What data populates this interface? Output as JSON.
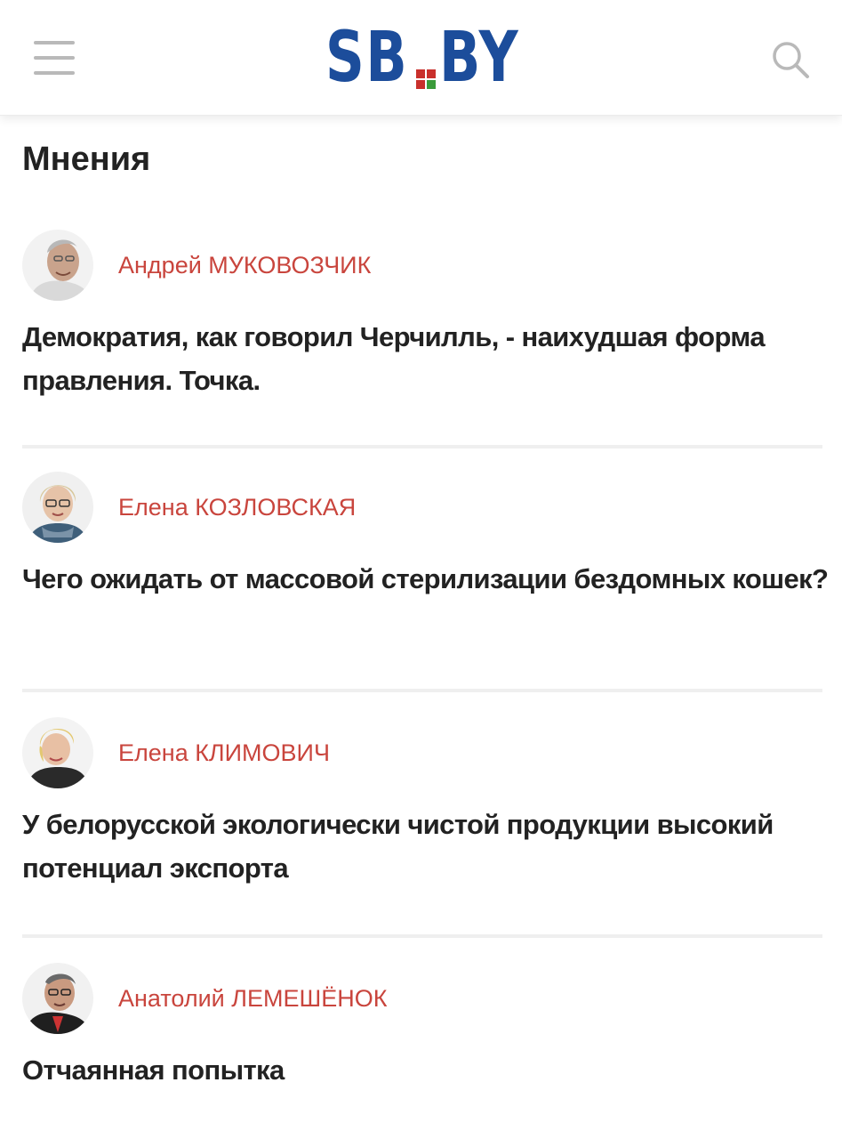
{
  "header": {
    "menu_icon": "hamburger-menu-icon",
    "logo": {
      "left": "SB",
      "right": "BY",
      "color": "#1c4d9b",
      "flag_colors": [
        "#c9302c",
        "#c9302c",
        "#c9302c",
        "#3a9b3a"
      ]
    },
    "search_icon": "search-icon"
  },
  "section": {
    "title": "Мнения"
  },
  "colors": {
    "author": "#c9453d",
    "headline": "#222222",
    "divider": "#efefef"
  },
  "articles": [
    {
      "author": "Андрей МУКОВОЗЧИК",
      "headline": "Демократия, как говорил Черчилль, - наихудшая форма правления. Точка."
    },
    {
      "author": "Елена КОЗЛОВСКАЯ",
      "headline": "Чего ожидать от массовой стерилизации бездомных кошек?"
    },
    {
      "author": "Елена КЛИМОВИЧ",
      "headline": "У белорусской экологически чистой продукции высокий потенциал экспорта"
    },
    {
      "author": "Анатолий ЛЕМЕШЁНОК",
      "headline": "Отчаянная попытка"
    }
  ]
}
